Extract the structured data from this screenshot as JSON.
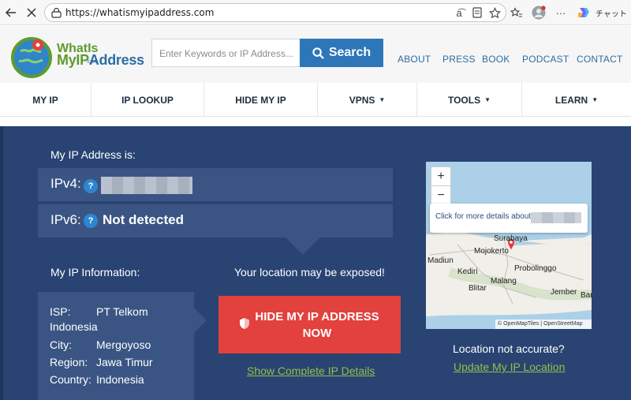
{
  "browser": {
    "url": "https://whatismyipaddress.com",
    "copilot_label": "チャット"
  },
  "header": {
    "logo_line1": "WhatIs",
    "logo_line2a": "MyIP",
    "logo_line2b": "Address",
    "logo_com": ".com",
    "search_placeholder": "Enter Keywords or IP Address...",
    "search_label": "Search",
    "links": [
      "ABOUT",
      "PRESS",
      "BOOK",
      "PODCAST",
      "CONTACT"
    ]
  },
  "nav": {
    "items": [
      {
        "label": "MY IP"
      },
      {
        "label": "IP LOOKUP"
      },
      {
        "label": "HIDE MY IP"
      },
      {
        "label": "VPNS"
      },
      {
        "label": "TOOLS"
      },
      {
        "label": "LEARN"
      }
    ]
  },
  "hero": {
    "ip_heading": "My IP Address is:",
    "ipv4_label": "IPv4:",
    "ipv6_label": "IPv6:",
    "ipv6_value": "Not detected",
    "help_glyph": "?",
    "info_heading": "My IP Information:",
    "exposed_text": "Your location may be exposed!",
    "info": {
      "isp_label": "ISP:",
      "isp_value": "PT Telkom",
      "isp_value2": "Indonesia",
      "city_label": "City:",
      "city_value": "Mergoyoso",
      "region_label": "Region:",
      "region_value": "Jawa Timur",
      "country_label": "Country:",
      "country_value": "Indonesia"
    },
    "hide_button_line1": "HIDE MY IP ADDRESS",
    "hide_button_line2": "NOW",
    "details_link": "Show Complete IP Details",
    "location_question": "Location not accurate?",
    "update_link": "Update My IP Location"
  },
  "map": {
    "zoom_in": "+",
    "zoom_out": "−",
    "popup_text": "Click for more details about",
    "cities": [
      "Surabaya",
      "Mojokerto",
      "Madiun",
      "Kediri",
      "Probolinggo",
      "Malang",
      "Blitar",
      "Jember",
      "Bar"
    ],
    "attribution": "© OpenMapTiles | OpenStreetMap"
  }
}
